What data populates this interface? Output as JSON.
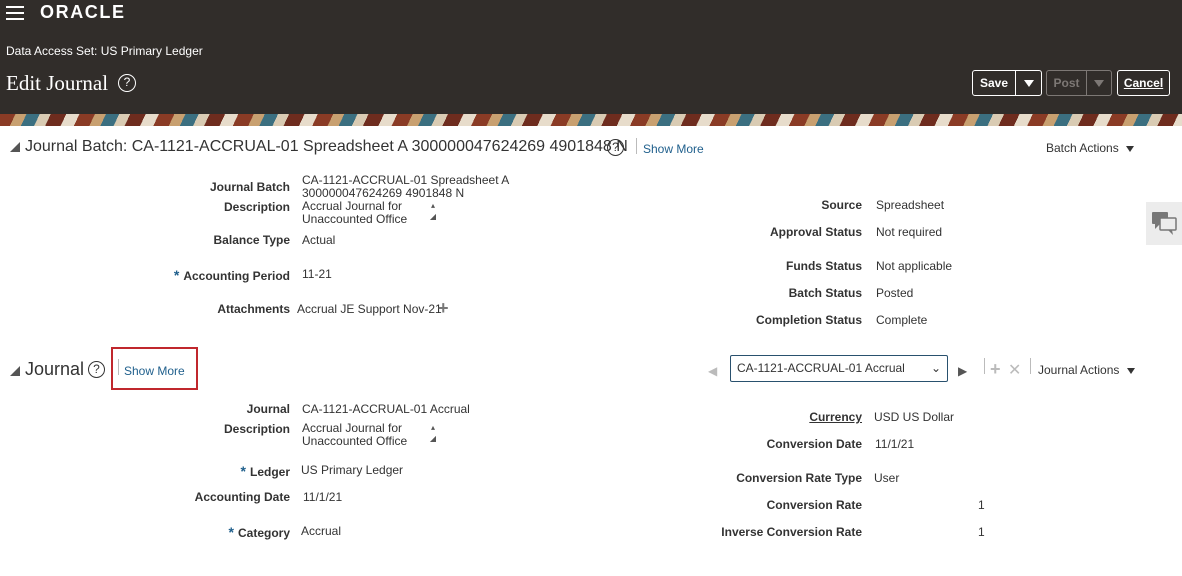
{
  "header": {
    "brand": "ORACLE",
    "data_access_set": "Data Access Set: US Primary Ledger",
    "page_title": "Edit Journal",
    "help_glyph": "?",
    "save_label": "Save",
    "post_label": "Post",
    "cancel_label": "Cancel"
  },
  "batch": {
    "title": "Journal Batch: CA-1121-ACCRUAL-01 Spreadsheet A 300000047624269 4901848 N",
    "show_more": "Show More",
    "actions": "Batch Actions",
    "fields": {
      "journal_batch_label": "Journal Batch",
      "journal_batch_value_line1": "CA-1121-ACCRUAL-01 Spreadsheet A",
      "journal_batch_value_line2": "300000047624269 4901848 N",
      "description_label": "Description",
      "description_line1": "Accrual Journal for",
      "description_line2": "Unaccounted Office",
      "balance_type_label": "Balance Type",
      "balance_type_value": "Actual",
      "accounting_period_label": "Accounting Period",
      "accounting_period_value": "11-21",
      "attachments_label": "Attachments",
      "attachments_value": "Accrual JE Support Nov-21",
      "source_label": "Source",
      "source_value": "Spreadsheet",
      "approval_status_label": "Approval Status",
      "approval_status_value": "Not required",
      "funds_status_label": "Funds Status",
      "funds_status_value": "Not applicable",
      "batch_status_label": "Batch Status",
      "batch_status_value": "Posted",
      "completion_status_label": "Completion Status",
      "completion_status_value": "Complete"
    }
  },
  "journal": {
    "title": "Journal",
    "show_more": "Show More",
    "selector_value": "CA-1121-ACCRUAL-01 Accrual",
    "actions": "Journal Actions",
    "fields": {
      "journal_label": "Journal",
      "journal_value": "CA-1121-ACCRUAL-01 Accrual",
      "description_label": "Description",
      "description_line1": "Accrual Journal for",
      "description_line2": "Unaccounted Office",
      "ledger_label": "Ledger",
      "ledger_value": "US Primary Ledger",
      "accounting_date_label": "Accounting Date",
      "accounting_date_value": "11/1/21",
      "category_label": "Category",
      "category_value": "Accrual",
      "currency_label": "Currency",
      "currency_value": "USD US Dollar",
      "conversion_date_label": "Conversion Date",
      "conversion_date_value": "11/1/21",
      "conversion_rate_type_label": "Conversion Rate Type",
      "conversion_rate_type_value": "User",
      "conversion_rate_label": "Conversion Rate",
      "conversion_rate_value": "1",
      "inverse_conversion_rate_label": "Inverse Conversion Rate",
      "inverse_conversion_rate_value": "1"
    }
  },
  "required_mark": "*",
  "colors": {
    "header_bg": "#312d2a",
    "link": "#1f5f8c",
    "highlight": "#c0272d"
  },
  "icons": [
    "hamburger-menu-icon",
    "help-icon",
    "chevron-down-icon",
    "collapse-triangle-icon",
    "plus-icon",
    "delete-x-icon",
    "prev-arrow-icon",
    "next-arrow-icon",
    "chat-bubbles-icon",
    "resize-handle-icon",
    "spin-arrows-icon"
  ]
}
